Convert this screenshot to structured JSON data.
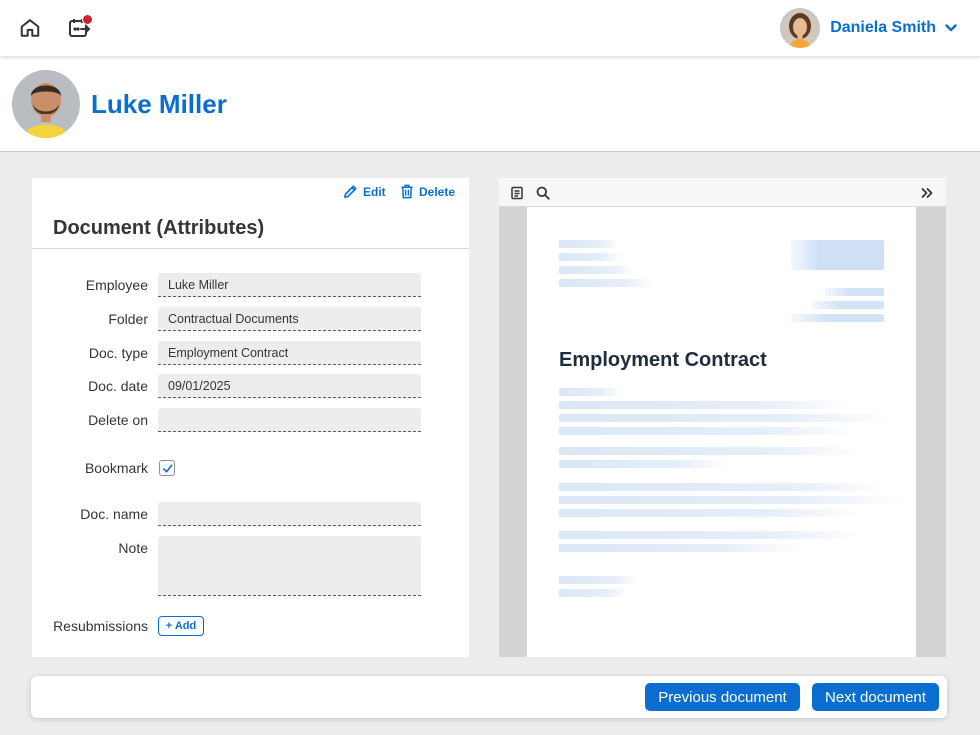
{
  "shell": {
    "home_icon": "home-icon",
    "calendar_icon": "calendar-event-icon",
    "notification_dot_color": "#d32030",
    "user_name": "Daniela Smith"
  },
  "header": {
    "title": "Luke Miller"
  },
  "attributes": {
    "edit_label": "Edit",
    "delete_label": "Delete",
    "title": "Document (Attributes)",
    "fields": {
      "employee": {
        "label": "Employee",
        "value": "Luke Miller"
      },
      "folder": {
        "label": "Folder",
        "value": "Contractual Documents"
      },
      "doc_type": {
        "label": "Doc. type",
        "value": "Employment Contract"
      },
      "doc_date": {
        "label": "Doc. date",
        "value": "09/01/2025"
      },
      "delete_on": {
        "label": "Delete on",
        "value": ""
      },
      "bookmark": {
        "label": "Bookmark",
        "checked": true
      },
      "doc_name": {
        "label": "Doc. name",
        "value": ""
      },
      "note": {
        "label": "Note",
        "value": ""
      },
      "resubmissions": {
        "label": "Resubmissions",
        "add_label": "+ Add"
      }
    }
  },
  "viewer": {
    "document_heading": "Employment Contract"
  },
  "footer": {
    "previous_label": "Previous document",
    "next_label": "Next document"
  },
  "colors": {
    "accent": "#0a6ed1",
    "background": "#ededed"
  }
}
